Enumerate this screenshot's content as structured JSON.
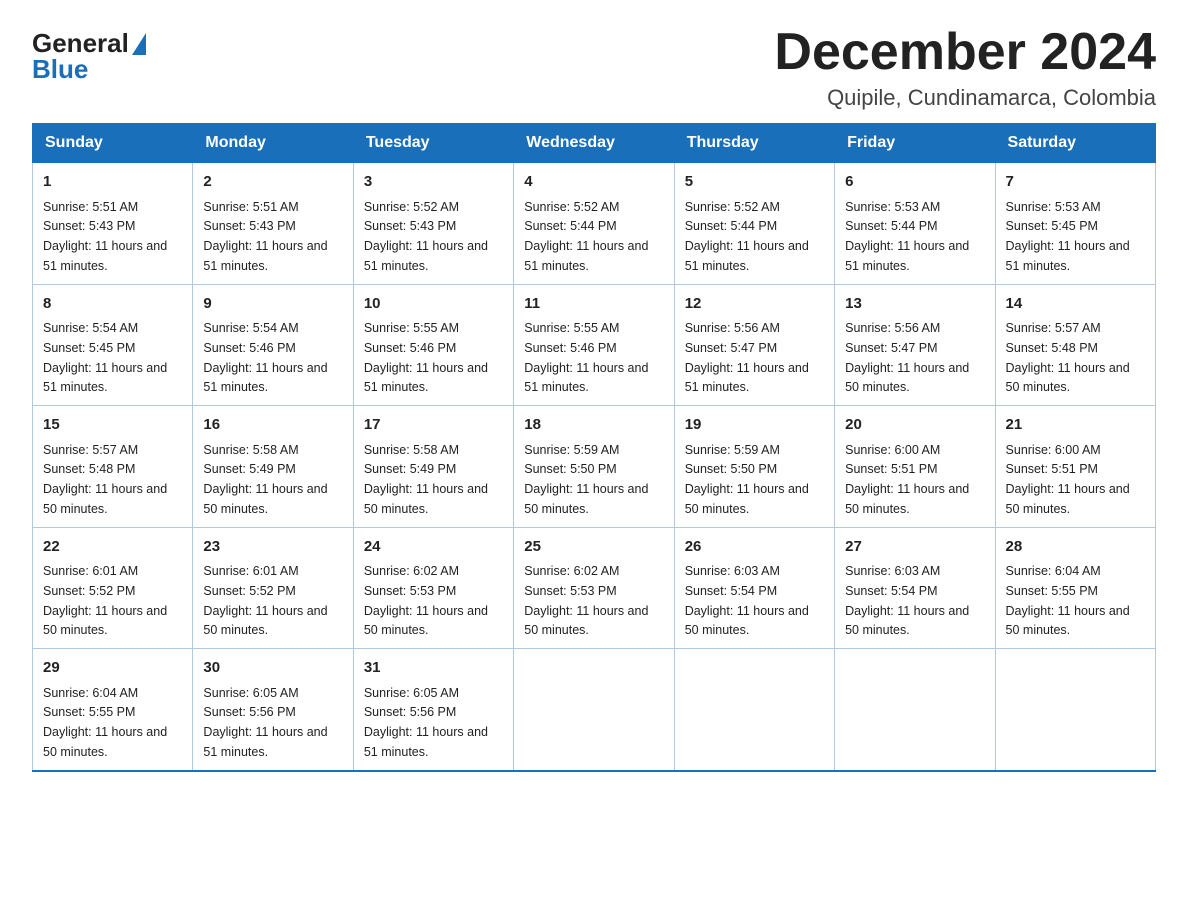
{
  "logo": {
    "general": "General",
    "blue": "Blue"
  },
  "header": {
    "month_year": "December 2024",
    "location": "Quipile, Cundinamarca, Colombia"
  },
  "days_of_week": [
    "Sunday",
    "Monday",
    "Tuesday",
    "Wednesday",
    "Thursday",
    "Friday",
    "Saturday"
  ],
  "weeks": [
    [
      {
        "num": "1",
        "sunrise": "5:51 AM",
        "sunset": "5:43 PM",
        "daylight": "11 hours and 51 minutes."
      },
      {
        "num": "2",
        "sunrise": "5:51 AM",
        "sunset": "5:43 PM",
        "daylight": "11 hours and 51 minutes."
      },
      {
        "num": "3",
        "sunrise": "5:52 AM",
        "sunset": "5:43 PM",
        "daylight": "11 hours and 51 minutes."
      },
      {
        "num": "4",
        "sunrise": "5:52 AM",
        "sunset": "5:44 PM",
        "daylight": "11 hours and 51 minutes."
      },
      {
        "num": "5",
        "sunrise": "5:52 AM",
        "sunset": "5:44 PM",
        "daylight": "11 hours and 51 minutes."
      },
      {
        "num": "6",
        "sunrise": "5:53 AM",
        "sunset": "5:44 PM",
        "daylight": "11 hours and 51 minutes."
      },
      {
        "num": "7",
        "sunrise": "5:53 AM",
        "sunset": "5:45 PM",
        "daylight": "11 hours and 51 minutes."
      }
    ],
    [
      {
        "num": "8",
        "sunrise": "5:54 AM",
        "sunset": "5:45 PM",
        "daylight": "11 hours and 51 minutes."
      },
      {
        "num": "9",
        "sunrise": "5:54 AM",
        "sunset": "5:46 PM",
        "daylight": "11 hours and 51 minutes."
      },
      {
        "num": "10",
        "sunrise": "5:55 AM",
        "sunset": "5:46 PM",
        "daylight": "11 hours and 51 minutes."
      },
      {
        "num": "11",
        "sunrise": "5:55 AM",
        "sunset": "5:46 PM",
        "daylight": "11 hours and 51 minutes."
      },
      {
        "num": "12",
        "sunrise": "5:56 AM",
        "sunset": "5:47 PM",
        "daylight": "11 hours and 51 minutes."
      },
      {
        "num": "13",
        "sunrise": "5:56 AM",
        "sunset": "5:47 PM",
        "daylight": "11 hours and 50 minutes."
      },
      {
        "num": "14",
        "sunrise": "5:57 AM",
        "sunset": "5:48 PM",
        "daylight": "11 hours and 50 minutes."
      }
    ],
    [
      {
        "num": "15",
        "sunrise": "5:57 AM",
        "sunset": "5:48 PM",
        "daylight": "11 hours and 50 minutes."
      },
      {
        "num": "16",
        "sunrise": "5:58 AM",
        "sunset": "5:49 PM",
        "daylight": "11 hours and 50 minutes."
      },
      {
        "num": "17",
        "sunrise": "5:58 AM",
        "sunset": "5:49 PM",
        "daylight": "11 hours and 50 minutes."
      },
      {
        "num": "18",
        "sunrise": "5:59 AM",
        "sunset": "5:50 PM",
        "daylight": "11 hours and 50 minutes."
      },
      {
        "num": "19",
        "sunrise": "5:59 AM",
        "sunset": "5:50 PM",
        "daylight": "11 hours and 50 minutes."
      },
      {
        "num": "20",
        "sunrise": "6:00 AM",
        "sunset": "5:51 PM",
        "daylight": "11 hours and 50 minutes."
      },
      {
        "num": "21",
        "sunrise": "6:00 AM",
        "sunset": "5:51 PM",
        "daylight": "11 hours and 50 minutes."
      }
    ],
    [
      {
        "num": "22",
        "sunrise": "6:01 AM",
        "sunset": "5:52 PM",
        "daylight": "11 hours and 50 minutes."
      },
      {
        "num": "23",
        "sunrise": "6:01 AM",
        "sunset": "5:52 PM",
        "daylight": "11 hours and 50 minutes."
      },
      {
        "num": "24",
        "sunrise": "6:02 AM",
        "sunset": "5:53 PM",
        "daylight": "11 hours and 50 minutes."
      },
      {
        "num": "25",
        "sunrise": "6:02 AM",
        "sunset": "5:53 PM",
        "daylight": "11 hours and 50 minutes."
      },
      {
        "num": "26",
        "sunrise": "6:03 AM",
        "sunset": "5:54 PM",
        "daylight": "11 hours and 50 minutes."
      },
      {
        "num": "27",
        "sunrise": "6:03 AM",
        "sunset": "5:54 PM",
        "daylight": "11 hours and 50 minutes."
      },
      {
        "num": "28",
        "sunrise": "6:04 AM",
        "sunset": "5:55 PM",
        "daylight": "11 hours and 50 minutes."
      }
    ],
    [
      {
        "num": "29",
        "sunrise": "6:04 AM",
        "sunset": "5:55 PM",
        "daylight": "11 hours and 50 minutes."
      },
      {
        "num": "30",
        "sunrise": "6:05 AM",
        "sunset": "5:56 PM",
        "daylight": "11 hours and 51 minutes."
      },
      {
        "num": "31",
        "sunrise": "6:05 AM",
        "sunset": "5:56 PM",
        "daylight": "11 hours and 51 minutes."
      },
      null,
      null,
      null,
      null
    ]
  ]
}
